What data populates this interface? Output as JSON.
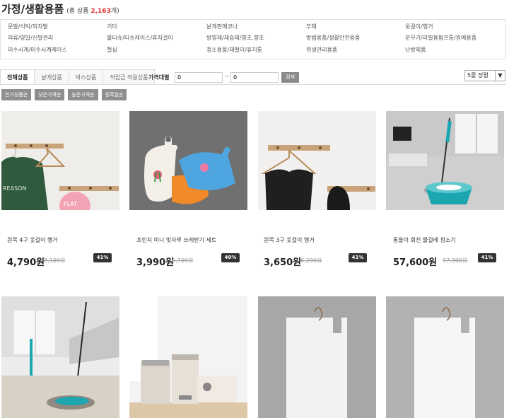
{
  "header": {
    "title": "가정/생활용품",
    "count_prefix": "(총 상품 ",
    "count": "2,163",
    "count_suffix": "개)"
  },
  "categories": [
    [
      "문발/식탁/의자발",
      "기타",
      "낱개판매코너",
      "부채",
      "옷걸이/행거"
    ],
    [
      "의류/양말/신발관리",
      "물티슈/티슈케이스/휴지걸이",
      "방향제/제습제/향초,향초",
      "방범용품/생활안전용품",
      "분무기/리필용펌프통/원예용품"
    ],
    [
      "미수시계/미수시계케이스",
      "철심",
      "청소용품/재떨이/휴지통",
      "위생관리용품",
      "난방제품"
    ]
  ],
  "tabs": [
    "전체상품",
    "낱개상품",
    "박스상품",
    "적립금 적용상품"
  ],
  "price_filter": {
    "label": "가격대별",
    "min": "0",
    "max": "0",
    "tilde": "~",
    "search": "검색"
  },
  "sort_select": {
    "value": "5줄 정렬"
  },
  "sort_buttons": [
    "인기상품순",
    "낮은가격순",
    "높은가격순",
    "등록일순"
  ],
  "products": [
    {
      "name": "원목 4구 옷걸이 행거",
      "price": "4,790원",
      "orig": "8,100원",
      "discount": "41%"
    },
    {
      "name": "프린지 미니 빗자루 쓰레받기 세트",
      "price": "3,990원",
      "orig": "6,700원",
      "discount": "40%"
    },
    {
      "name": "원목 3구 옷걸이 행거",
      "price": "3,650원",
      "orig": "6,200원",
      "discount": "41%"
    },
    {
      "name": "통돌이 회전 물걸레 청소기",
      "price": "57,600원",
      "orig": "97,300원",
      "discount": "41%"
    },
    {
      "name": "",
      "price": "",
      "orig": "",
      "discount": ""
    },
    {
      "name": "",
      "price": "",
      "orig": "",
      "discount": ""
    },
    {
      "name": "",
      "price": "",
      "orig": "",
      "discount": ""
    },
    {
      "name": "",
      "price": "",
      "orig": "",
      "discount": ""
    }
  ],
  "image_texts": {
    "sweater": "REASON",
    "cap": "FLAT"
  },
  "colors": {
    "accent": "#e03434",
    "badge": "#333333",
    "gray_button": "#8f8f8f"
  }
}
